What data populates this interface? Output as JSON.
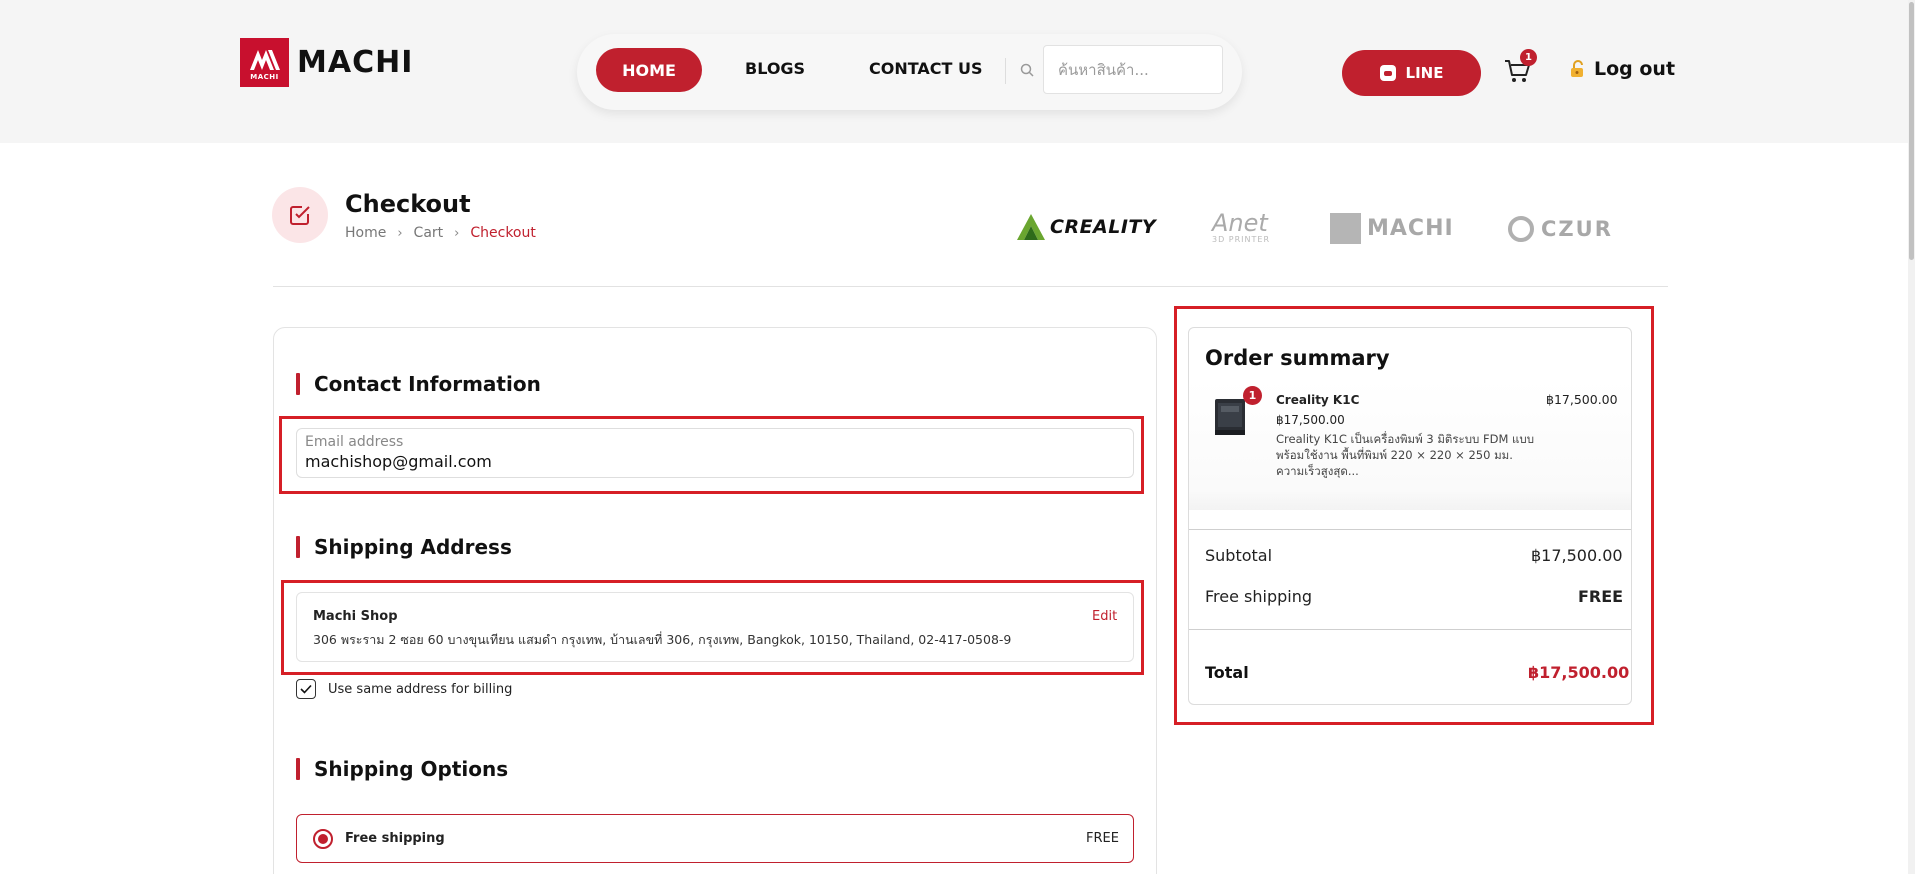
{
  "header": {
    "logo_text": "MACHI",
    "logo_mark_text": "MACHI",
    "nav": {
      "home": "HOME",
      "blogs": "BLOGS",
      "contact": "CONTACT US"
    },
    "search": {
      "placeholder": "ค้นหาสินค้า..."
    },
    "line_button": "LINE",
    "cart_count": "1",
    "logout": "Log out"
  },
  "page": {
    "title": "Checkout",
    "breadcrumb": [
      "Home",
      "Cart",
      "Checkout"
    ],
    "brands": {
      "creality": "CREALITY",
      "anet": "Anet",
      "anet_sub": "3D PRINTER",
      "machi": "MACHI",
      "czur": "CZUR"
    }
  },
  "contact": {
    "title": "Contact Information",
    "email_label": "Email address",
    "email_value": "machishop@gmail.com"
  },
  "shipping_address": {
    "title": "Shipping Address",
    "name": "Machi Shop",
    "address": "306 พระราม 2 ซอย 60 บางขุนเทียน แสมดำ กรุงเทพ, บ้านเลขที่ 306, กรุงเทพ, Bangkok, 10150, Thailand, 02-417-0508-9",
    "edit": "Edit",
    "billing_same": "Use same address for billing",
    "billing_same_checked": true
  },
  "shipping_options": {
    "title": "Shipping Options",
    "options": [
      {
        "label": "Free shipping",
        "price": "FREE",
        "selected": true
      }
    ]
  },
  "order_summary": {
    "title": "Order summary",
    "items": [
      {
        "quantity": "1",
        "name": "Creality K1C",
        "unit_price": "฿17,500.00",
        "description": "Creality K1C เป็นเครื่องพิมพ์ 3 มิติระบบ FDM แบบพร้อมใช้งาน พื้นที่พิมพ์ 220 × 220 × 250 มม. ความเร็วสูงสุด...",
        "line_total": "฿17,500.00"
      }
    ],
    "subtotal_label": "Subtotal",
    "subtotal_value": "฿17,500.00",
    "shipping_label": "Free shipping",
    "shipping_value": "FREE",
    "total_label": "Total",
    "total_value": "฿17,500.00"
  },
  "colors": {
    "brand_red": "#c0202e",
    "highlight_red": "#d61f26"
  }
}
